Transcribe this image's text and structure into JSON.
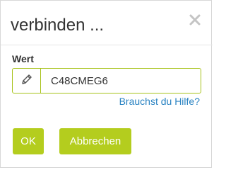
{
  "dialog": {
    "title": "verbinden ...",
    "close_icon": "close-icon"
  },
  "field": {
    "label": "Wert",
    "icon": "pencil-icon",
    "value": "C48CMEG6"
  },
  "help_link": "Brauchst du Hilfe?",
  "buttons": {
    "ok_label": "OK",
    "cancel_label": "Abbrechen"
  },
  "colors": {
    "accent": "#b4cd1e",
    "input_border": "#a7c21a",
    "link": "#2a83c2",
    "text": "#333333"
  }
}
